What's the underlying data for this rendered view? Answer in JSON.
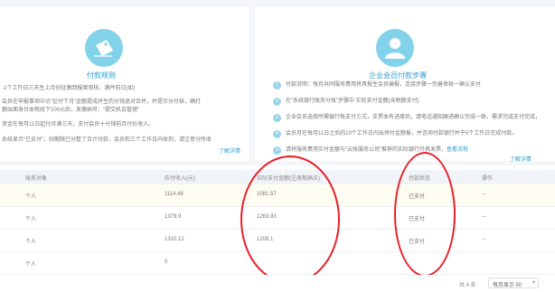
{
  "left_card": {
    "title": "付款规则",
    "lines": [
      "-1个工作日三天生上月份征缴回报案审核，满件前日(如)",
      "会员在申报事项中点“征付下月”金额提成并生的分钱退对合并，并提示分付核，确打",
      "额出面身付本税经下100元后，发缴纳可：“提交机会管理”",
      "资金在每月11日起付月满三天，支付会员十分钱前月付价收入。",
      "系统显示“已支付”，则期限已分整了合计付款，会员和三个工作日内收到，请注意分所收"
    ],
    "more": "了解详情"
  },
  "right_card": {
    "title": "企业会员付款步骤",
    "steps": [
      {
        "num": "1",
        "text": "付款说明：每月共同服务费用将具报生会员编报，连接步骤一完善审核一确认支付"
      },
      {
        "num": "2",
        "text": "在“系统银行账务分账”步骤中 ",
        "highlight": "实际支付金额(含税额支付)"
      },
      {
        "num": "3",
        "text": "企业会员选择所需银行帐支付方式，支票本有进度后，请电话通知跟进确认完成一致，需求完成支付完成，"
      },
      {
        "num": "4",
        "text": "会员月在每月11日之后的10个工作日内出预付金额报，并咨询付款银行并于5个工作日完成付款。"
      },
      {
        "num": "5",
        "text": "请将服务费用实付金额与“云账服务公司”推荐的实际银行开具发票，",
        "highlight": "查看流程"
      }
    ],
    "more": "了解详情"
  },
  "table": {
    "headers": {
      "type": "账务对象",
      "due": "应付收入(元)",
      "actual": "实际支付金额(注册期高应)",
      "status": "付款状态",
      "op": "操作"
    },
    "rows": [
      {
        "type": "个人",
        "due": "1114.48",
        "actual": "1081.57",
        "status": "已支付",
        "op": "--"
      },
      {
        "type": "个人",
        "due": "1379.9",
        "actual": "1263.93",
        "status": "已支付",
        "op": "--"
      },
      {
        "type": "个人",
        "due": "1310.12",
        "actual": "1208.1",
        "status": "已支付",
        "op": "--"
      },
      {
        "type": "个人",
        "due": "0",
        "actual": "",
        "status": "",
        "op": ""
      }
    ]
  },
  "pager": {
    "total": "共 4 条",
    "page_size": "每页显示 50",
    "caret": "▾"
  },
  "colors": {
    "accent": "#2b9fd0",
    "icon_bg": "#82d2e9",
    "annotation": "#e8202a",
    "header_bg": "#f0f3f7"
  }
}
